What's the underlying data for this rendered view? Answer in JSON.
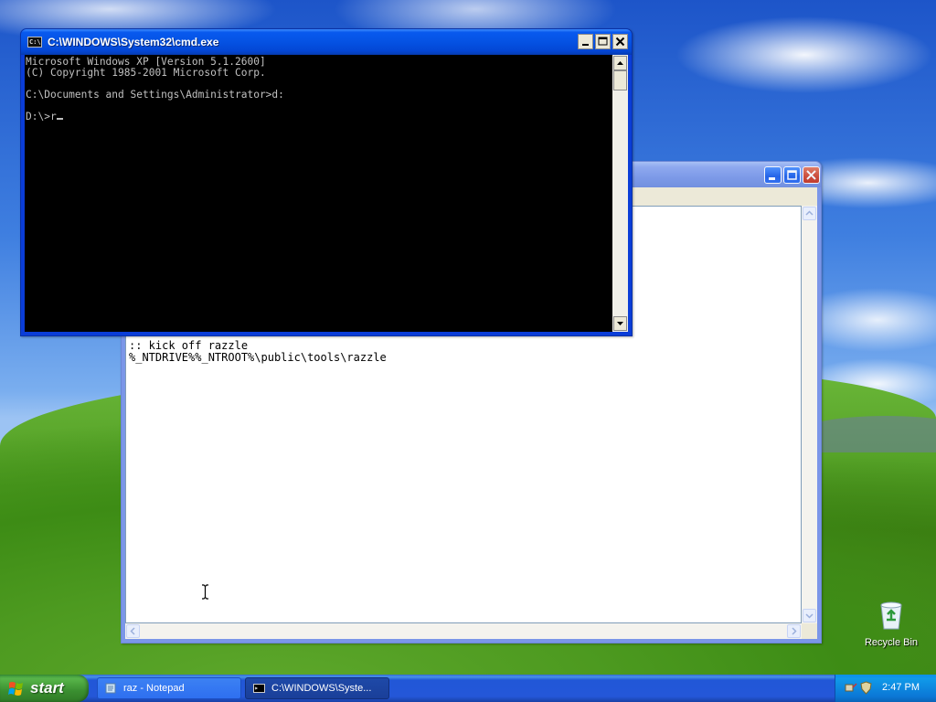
{
  "desktop": {
    "recycle_bin_label": "Recycle Bin"
  },
  "notepad": {
    "title": "",
    "content": ":: kick off razzle\n%_NTDRIVE%%_NTROOT%\\public\\tools\\razzle"
  },
  "cmd": {
    "title": "C:\\WINDOWS\\System32\\cmd.exe",
    "lines": [
      "Microsoft Windows XP [Version 5.1.2600]",
      "(C) Copyright 1985-2001 Microsoft Corp.",
      "",
      "C:\\Documents and Settings\\Administrator>d:",
      ""
    ],
    "prompt": "D:\\>",
    "typed": "r"
  },
  "taskbar": {
    "start_label": "start",
    "tasks": [
      {
        "label": "raz - Notepad",
        "icon": "notepad-icon"
      },
      {
        "label": "C:\\WINDOWS\\Syste...",
        "icon": "cmd-icon"
      }
    ],
    "clock": "2:47 PM"
  },
  "colors": {
    "titlebar_active": "#0552e3",
    "taskbar": "#2457d8",
    "start_button": "#3a8f30",
    "console_bg": "#000000",
    "console_fg": "#c0c0c0"
  }
}
